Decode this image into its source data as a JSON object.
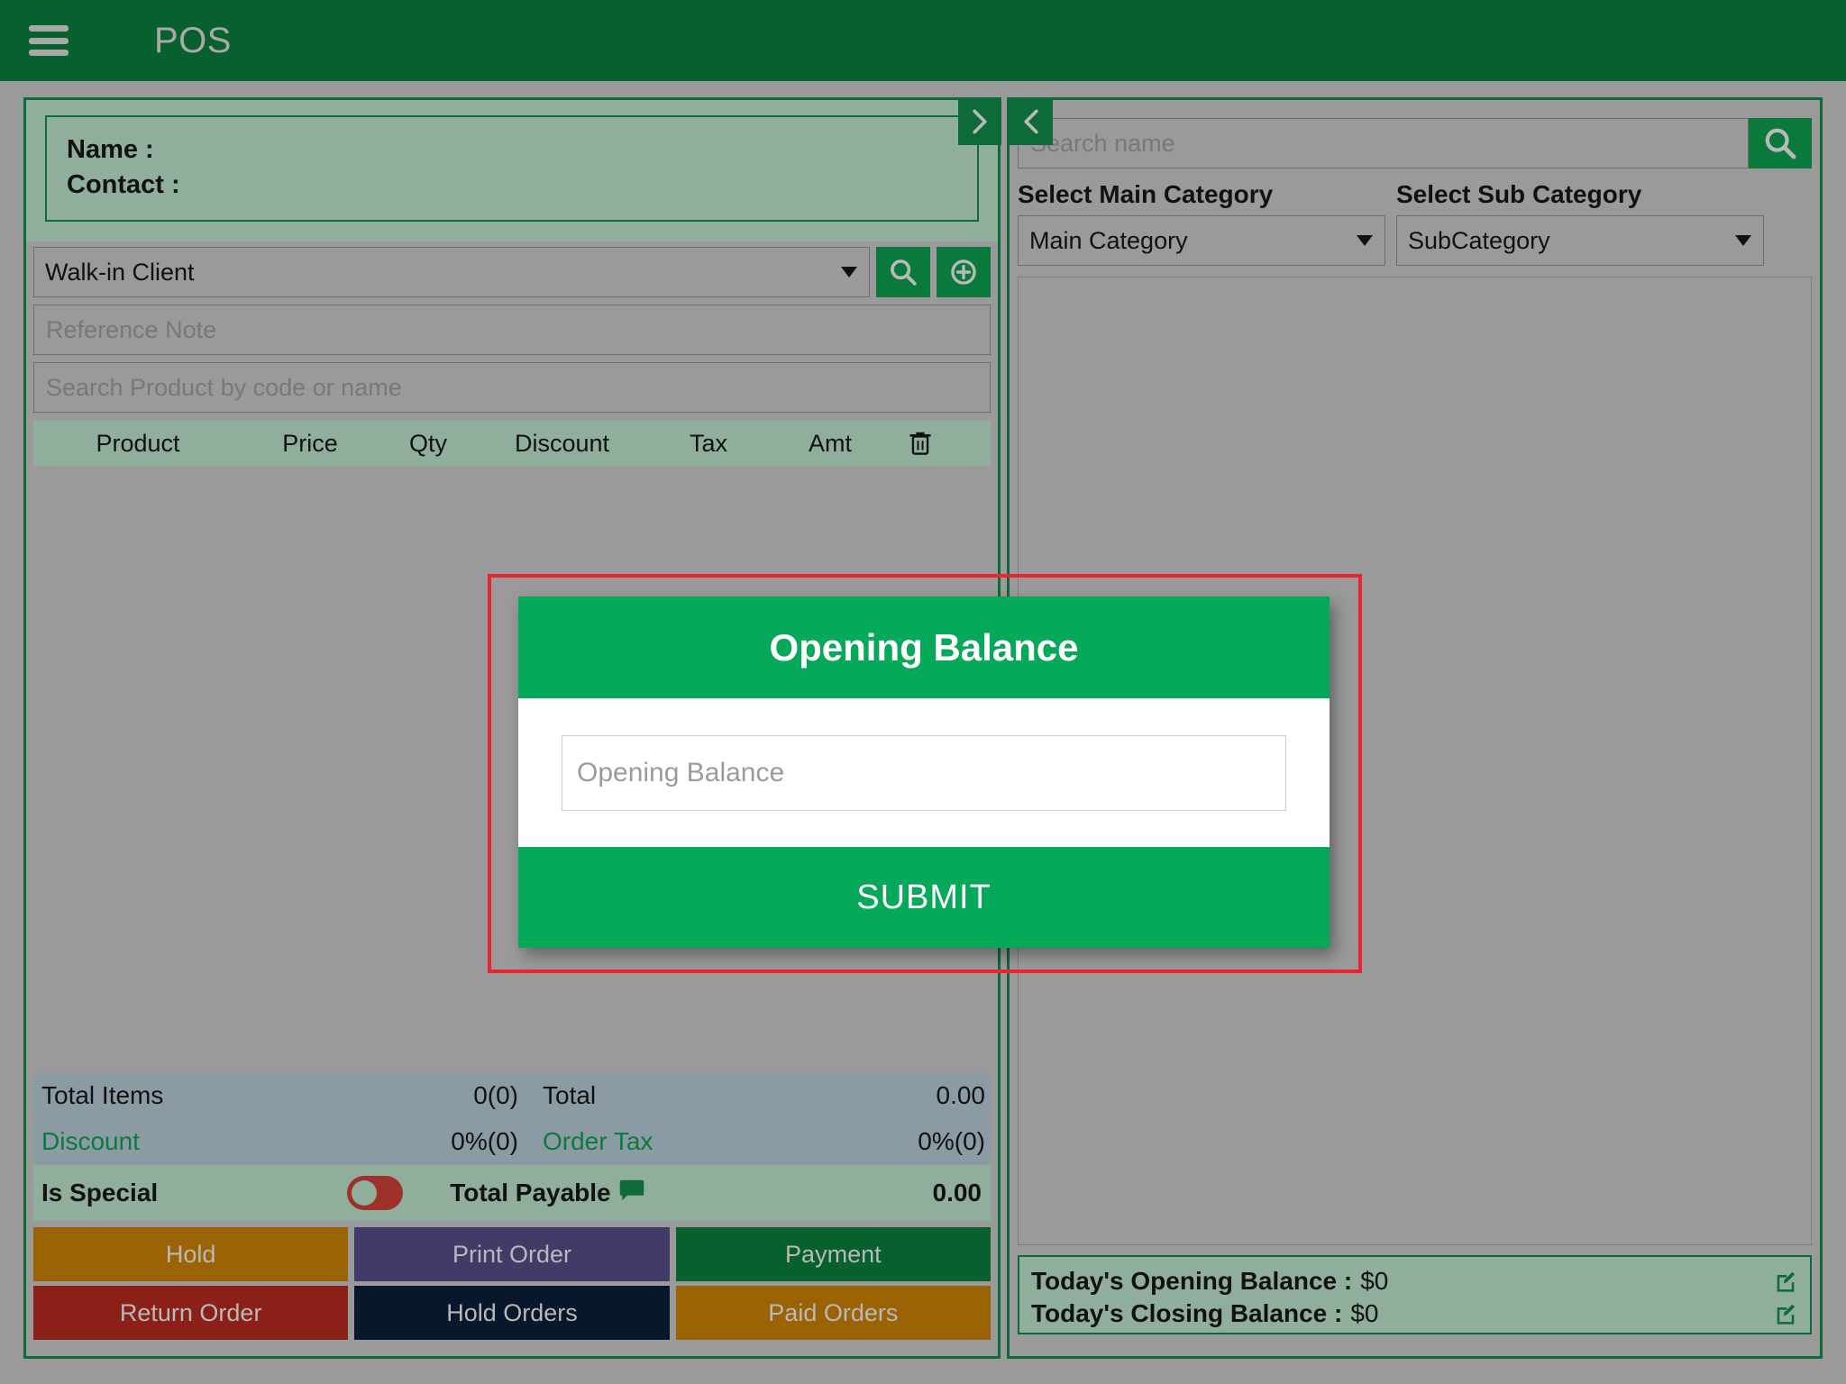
{
  "header": {
    "menu_icon": "hamburger-icon",
    "title": "POS"
  },
  "left_panel": {
    "customer": {
      "name_label": "Name :",
      "contact_label": "Contact :"
    },
    "client_select": {
      "value": "Walk-in Client",
      "search_icon": "search-icon",
      "add_icon": "plus-circle-icon"
    },
    "reference_note_placeholder": "Reference Note",
    "product_search_placeholder": "Search Product by code or name",
    "table_headers": [
      "Product",
      "Price",
      "Qty",
      "Discount",
      "Tax",
      "Amt"
    ],
    "table_delete_icon": "trash-icon",
    "totals": {
      "total_items_label": "Total Items",
      "total_items_value": "0(0)",
      "total_label": "Total",
      "total_value": "0.00",
      "discount_label": "Discount",
      "discount_value": "0%(0)",
      "order_tax_label": "Order Tax",
      "order_tax_value": "0%(0)",
      "is_special_label": "Is Special",
      "is_special_state": "off",
      "total_payable_label": "Total Payable",
      "total_payable_icon": "comment-bubble-icon",
      "total_payable_value": "0.00"
    },
    "buttons": [
      {
        "label": "Hold",
        "color": "#9c6305"
      },
      {
        "label": "Print Order",
        "color": "#413b68"
      },
      {
        "label": "Payment",
        "color": "#06612e"
      },
      {
        "label": "Return Order",
        "color": "#8b2018"
      },
      {
        "label": "Hold Orders",
        "color": "#07172c"
      },
      {
        "label": "Paid Orders",
        "color": "#9c6305"
      }
    ]
  },
  "panel_toggles": {
    "expand_left_icon": "chevron-right-icon",
    "collapse_right_icon": "chevron-left-icon"
  },
  "right_panel": {
    "search_placeholder": "Search name",
    "search_icon": "search-icon",
    "main_category_label": "Select Main Category",
    "sub_category_label": "Select Sub Category",
    "main_category_value": "Main Category",
    "sub_category_value": "SubCategory",
    "balance": {
      "opening_label": "Today's Opening Balance :",
      "opening_value": "$0",
      "closing_label": "Today's Closing Balance :",
      "closing_value": "$0",
      "edit_icon": "edit-pencil-icon"
    }
  },
  "modal": {
    "title": "Opening Balance",
    "input_placeholder": "Opening Balance",
    "input_value": "",
    "submit_label": "SUBMIT"
  },
  "annotation": {
    "color": "#ee2233",
    "shape": "rectangle"
  },
  "colors": {
    "header_green": "#06612e",
    "modal_green": "#06a859",
    "panel_border_green": "#0c6b38",
    "page_grey": "#9a9a9a",
    "accent_sage": "#8fae9b"
  }
}
